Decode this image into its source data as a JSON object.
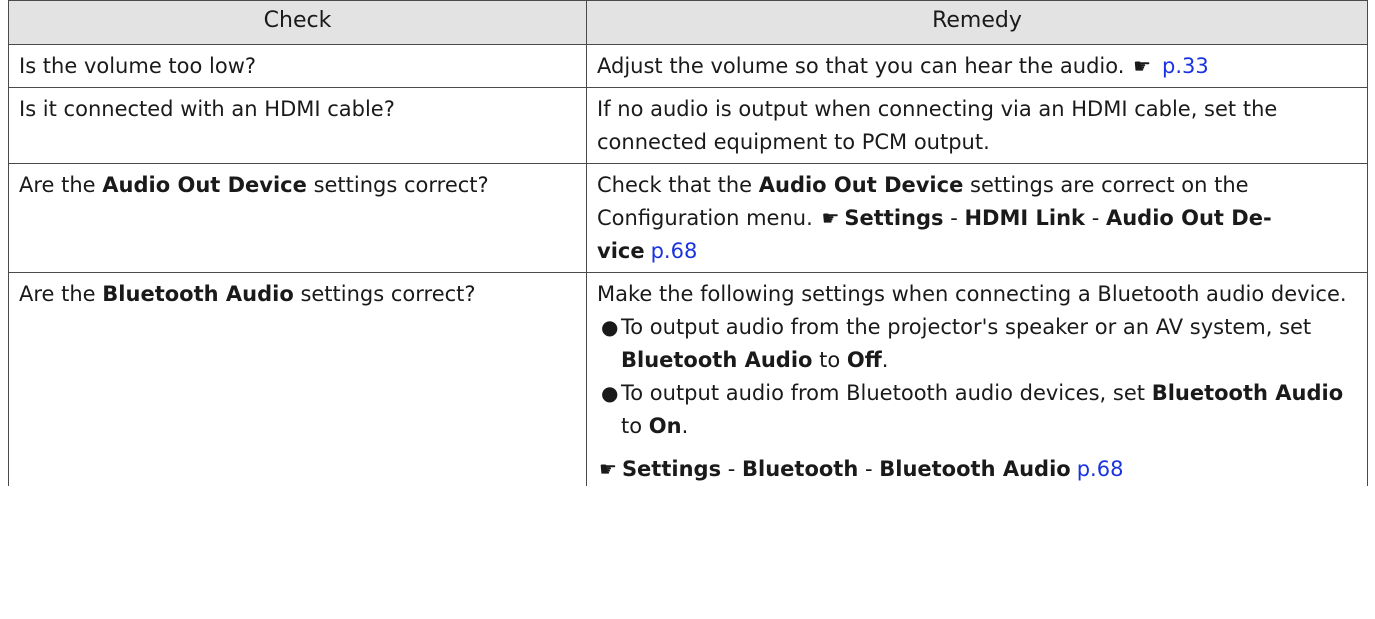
{
  "header": {
    "check": "Check",
    "remedy": "Remedy"
  },
  "rows": [
    {
      "check": "Is the volume too low?",
      "remedy_text": "Adjust the volume so that you can hear the audio.",
      "remedy_link": "p.33"
    },
    {
      "check": "Is it connected with an HDMI cable?",
      "remedy_text": "If no audio is output when connecting via an HDMI cable, set the connected equipment to PCM output."
    },
    {
      "check_pre": "Are the",
      "check_bold": "Audio Out Device",
      "check_post": "settings correct?",
      "remedy_pre": "Check that the",
      "remedy_bold": "Audio Out Device",
      "remedy_post": "settings are correct on the Configuration menu.",
      "path": [
        "Settings",
        "HDMI Link",
        "Audio Out Device"
      ],
      "path_last_first": "Audio Out De-",
      "path_last_second": "vice",
      "separator": "-",
      "remedy_link": "p.68"
    },
    {
      "check_pre": "Are the",
      "check_bold": "Bluetooth Audio",
      "check_post": "settings correct?",
      "intro": "Make the following settings when connecting a Bluetooth audio device.",
      "bullets": [
        {
          "pre": "To output audio from the projector's speaker or an AV system, set",
          "bold1": "Bluetooth Audio",
          "mid": "to",
          "bold2": "Off",
          "post": "."
        },
        {
          "pre": "To output audio from Bluetooth audio devices, set",
          "bold1": "Bluetooth Audio",
          "mid": "to",
          "bold2": "On",
          "post": "."
        }
      ],
      "path": [
        "Settings",
        "Bluetooth",
        "Bluetooth Audio"
      ],
      "separator": "-",
      "remedy_link": "p.68"
    }
  ],
  "icons": {
    "reference": "pointing-hand-icon",
    "bullet": "bullet-dot-icon"
  },
  "colors": {
    "header_bg": "#e3e3e3",
    "link": "#1a33e0",
    "border": "#4a4a4a"
  }
}
